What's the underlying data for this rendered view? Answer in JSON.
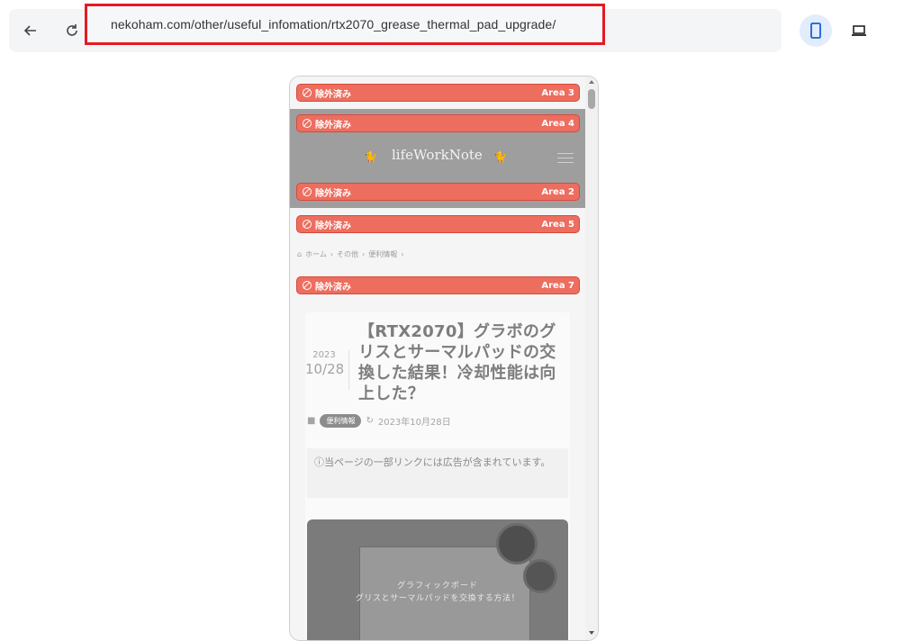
{
  "toolbar": {
    "back_icon": "arrow-left-icon",
    "reload_icon": "reload-icon",
    "url": "nekoham.com/other/useful_infomation/rtx2070_grease_thermal_pad_upgrade/",
    "device_mobile_icon": "smartphone-icon",
    "device_desktop_icon": "laptop-icon"
  },
  "areas": [
    {
      "status": "除外済み",
      "label": "Area 3"
    },
    {
      "status": "除外済み",
      "label": "Area 4"
    },
    {
      "status": "除外済み",
      "label": "Area 2"
    },
    {
      "status": "除外済み",
      "label": "Area 5"
    },
    {
      "status": "除外済み",
      "label": "Area 7"
    }
  ],
  "site": {
    "logo": "lifeWorkNote"
  },
  "breadcrumb": {
    "items": [
      "ホーム",
      "その他",
      "便利情報"
    ]
  },
  "article": {
    "date_year": "2023",
    "date_md": "10/28",
    "title": "【RTX2070】グラボのグリスとサーマルパッドの交換した結果！冷却性能は向上した？",
    "category": "便利情報",
    "updated": "2023年10月28日",
    "notice": "ⓘ当ページの一部リンクには広告が含まれています。",
    "hero_line1": "グラフィックボード",
    "hero_line2": "グリスとサーマルパッドを交換する方法！"
  },
  "colors": {
    "area_bar": "#ed6e5f",
    "highlight_border": "#e31b23",
    "active_device": "#e2ecfb"
  }
}
